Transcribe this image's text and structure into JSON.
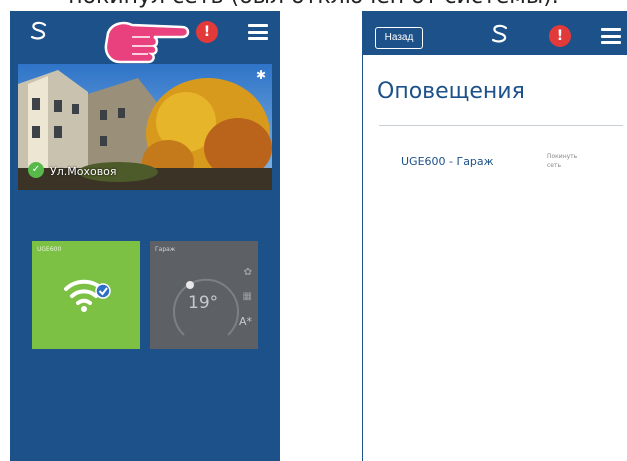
{
  "caption": "покинул сеть (был отключен от системы).",
  "left_screen": {
    "logo_icon": "logo-s-icon",
    "alert_symbol": "!",
    "location": {
      "label": "Ул.Моховоя"
    },
    "tiles": [
      {
        "title": "UGE600",
        "icon": "wifi-icon",
        "color": "#7cc144"
      },
      {
        "title": "Гараж",
        "temperature": "19°",
        "color": "#5d6166"
      }
    ]
  },
  "right_screen": {
    "back_label": "Назад",
    "alert_symbol": "!",
    "title": "Оповещения",
    "notifications": [
      {
        "device": "UGE600 - Гараж",
        "status": "Покинуть сеть"
      }
    ]
  },
  "colors": {
    "brand_blue": "#1c5189",
    "alert_red": "#e23a3a",
    "hand_pink": "#e8417e"
  }
}
